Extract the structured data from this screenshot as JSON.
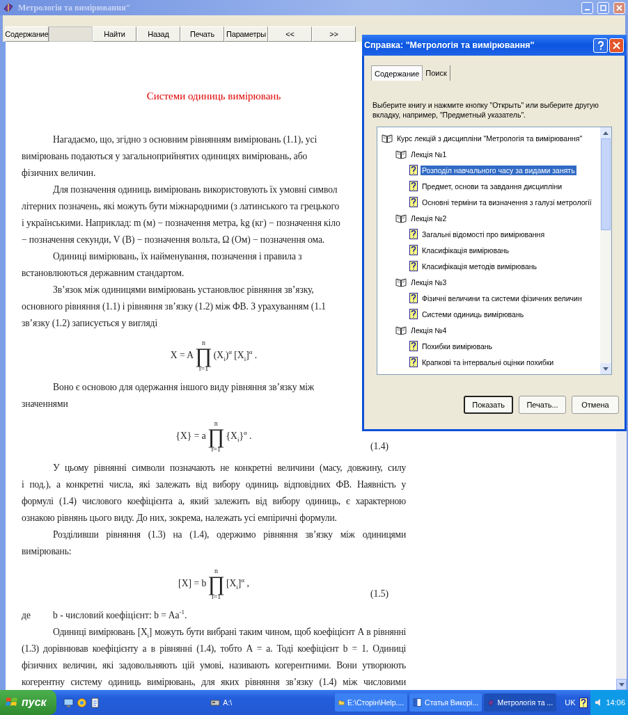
{
  "window": {
    "title": "Метрологія та вимірювання\"",
    "toolbar": [
      {
        "label": "Содержание",
        "disabled": false
      },
      {
        "disabled": true
      },
      {
        "label": "Найти",
        "disabled": false
      },
      {
        "label": "Назад",
        "disabled": false
      },
      {
        "label": "Печать",
        "disabled": false
      },
      {
        "label": "Параметры",
        "disabled": false
      },
      {
        "label": "<<",
        "disabled": false
      },
      {
        "label": ">>",
        "disabled": false
      }
    ]
  },
  "document": {
    "heading": "Системи одиниць вимірювань",
    "blocks": [
      {
        "kind": "first_short",
        "text": "Нагадаємо, що, згідно з основним рівнянням вимірювань (1.1), усі"
      },
      {
        "kind": "short",
        "text": "вимірювань подаються у загальноприйнятих одиницях вимірювань, або"
      },
      {
        "kind": "short",
        "text": "фізичних величин."
      },
      {
        "kind": "first_short",
        "text": "Для позначення одиниць вимірювань використовують їх умовні символ"
      },
      {
        "kind": "short",
        "text": "літерних позначень, які можуть бути міжнародними (з латинського та грецького"
      },
      {
        "kind": "short",
        "text": "і українськими. Наприклад: m (м) − позначення метра, kg (кг) − позначення кіло"
      },
      {
        "kind": "short",
        "text": "− позначення секунди, V (В) − позначення вольта, Ω (Ом) − позначення ома."
      },
      {
        "kind": "first_short",
        "text": "Одиниці вимірювань, їх найменування, позначення і правила з"
      },
      {
        "kind": "short",
        "text": "встановлюються державним стандартом."
      },
      {
        "kind": "first_short",
        "text": "Зв’язок між одиницями вимірювань установлює рівняння зв’язку,"
      },
      {
        "kind": "short",
        "text": "основного рівняння (1.1) і рівняння зв’язку (1.2) між ФВ. З урахуванням (1.1"
      },
      {
        "kind": "short",
        "text": "зв’язку (1.2) записується у вигляді"
      },
      {
        "kind": "formula",
        "left": "X = A",
        "product": {
          "top": "n",
          "symbol": "∏",
          "bottom": "i=1"
        },
        "right": "(X$_{i}$)$^{α}$ [X$_{i}$]$^{α}$ ."
      },
      {
        "kind": "first_short",
        "text": "Воно є основою для одержання іншого виду рівняння зв’язку між"
      },
      {
        "kind": "short",
        "text": "значеннями"
      },
      {
        "kind": "formula",
        "left": "{X} = a",
        "product": {
          "top": "n",
          "symbol": "∏",
          "bottom": "i=1"
        },
        "right": "{X$_{i}$}$^{α}$ .",
        "number": "(1.4)"
      },
      {
        "kind": "first",
        "text": "У цьому рівнянні символи позначають не конкретні величини (масу, довжину, силу"
      },
      {
        "kind": "body",
        "text": "і под.), а конкретні числа, які залежать від вибору одиниць відповідних ФВ. Наявність у"
      },
      {
        "kind": "body",
        "text": "формулі (1.4) числового коефіцієнта a, який залежить від вибору одиниць, є характерною"
      },
      {
        "kind": "short",
        "text": "ознакою рівнянь цього виду. До них, зокрема, належать усі емпіричні формули."
      },
      {
        "kind": "first",
        "text": "Розділивши рівняння (1.3) на (1.4), одержимо рівняння зв’язку між одиницями"
      },
      {
        "kind": "short",
        "text": "вимірювань:"
      },
      {
        "kind": "formula",
        "left": "[X] = b",
        "product": {
          "top": "n",
          "symbol": "∏",
          "bottom": "i=1"
        },
        "right": "[X$_{i}$]$^{α}$ ,",
        "number": "(1.5)"
      },
      {
        "kind": "where",
        "label": "де",
        "text": "b - числовий коефіцієнт: b = Aa$^{-1}$."
      },
      {
        "kind": "first",
        "text": "Одиниці вимірювань [X$_{i}$] можуть бути вибрані таким чином, щоб коефіцієнт A в рівнянні"
      },
      {
        "kind": "body",
        "text": "(1.3) дорівнював коефіцієнту a в рівнянні (1.4), тобто A = a. Тоді коефіцієнт b = 1. Одиниці"
      },
      {
        "kind": "body",
        "text": "фізичних величин, які задовольняють цій умові, називають когерентними. Вони утворюють"
      },
      {
        "kind": "body",
        "text": "когерентну систему одиниць вимірювань, для яких рівняння зв’язку (1.4) між числовими"
      }
    ]
  },
  "dialog": {
    "title": "Справка: \"Метрологія та вимірювання\"",
    "tabs": [
      {
        "label": "Содержание",
        "selected": true
      },
      {
        "label": "Поиск",
        "selected": false
      }
    ],
    "instruction": "Выберите книгу и нажмите кнопку \"Открыть\" или выберите другую вкладку, например, \"Предметный указатель\".",
    "tree": [
      {
        "label": "Курс лекцій з дисципліни \"Метрологія та вимірювання\"",
        "children": [
          {
            "label": "Лекція №1",
            "children": [
              {
                "label": "Розподіл навчального часу за видами занять",
                "selected": true
              },
              {
                "label": "Предмет, основи та завдання дисципліни",
                "selected": false
              },
              {
                "label": "Основні терміни та визначення з галузі метрології",
                "selected": false
              }
            ]
          },
          {
            "label": "Лекція №2",
            "children": [
              {
                "label": "Загальні відомості про вимірювання",
                "selected": false
              },
              {
                "label": "Класифікація вимірювань",
                "selected": false
              },
              {
                "label": "Класифікація методів вимірювань",
                "selected": false
              }
            ]
          },
          {
            "label": "Лекція №3",
            "children": [
              {
                "label": "Фізичні величини та системи фізичних величин",
                "selected": false
              },
              {
                "label": "Системи одиниць вимірювань",
                "selected": false
              }
            ]
          },
          {
            "label": "Лекція №4",
            "children": [
              {
                "label": "Похибки вимірювань",
                "selected": false
              },
              {
                "label": "Крапкові та інтервальні оцінки похибки",
                "selected": false
              }
            ]
          }
        ]
      }
    ],
    "buttons": [
      {
        "label": "Показать",
        "default": true
      },
      {
        "label": "Печать...",
        "default": false
      },
      {
        "label": "Отмена",
        "default": false
      }
    ]
  },
  "taskbar": {
    "start": "пуск",
    "tasks": [
      {
        "label": "A:\\",
        "active": false
      },
      {
        "label": "E:\\Сторін\\Help....",
        "active": false
      },
      {
        "label": "Статья Викорі...",
        "active": false
      },
      {
        "label": "Метрологія та ...",
        "active": true
      }
    ],
    "language": "UK",
    "clock": "14:06"
  }
}
